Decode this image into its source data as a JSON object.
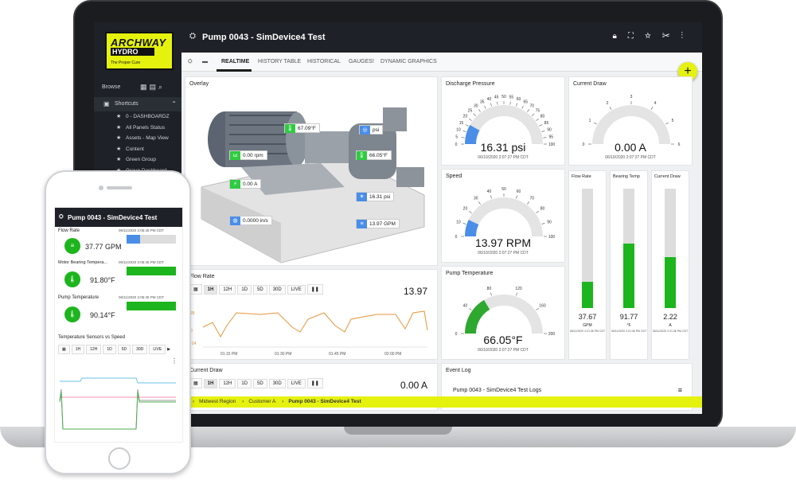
{
  "app": {
    "logo_line1": "ARCHWAY",
    "logo_line2": "HYDRO",
    "logo_tagline": "The Proper Cure",
    "title": "Pump 0043 - SimDevice4 Test",
    "accent": "#e5f20d"
  },
  "sidebar": {
    "browse_label": "Browse",
    "shortcuts_label": "Shortcuts",
    "items": [
      {
        "label": "0 - DASHBOARDZ"
      },
      {
        "label": "All Panels Status"
      },
      {
        "label": "Assets - Map View"
      },
      {
        "label": "Content"
      },
      {
        "label": "Green Group"
      },
      {
        "label": "Group Dashboard"
      }
    ]
  },
  "header": {
    "icons": [
      "lock-icon",
      "fullscreen-icon",
      "star-icon",
      "tools-icon",
      "more-icon"
    ]
  },
  "tabs": [
    {
      "label": "REALTIME"
    },
    {
      "label": "HISTORY TABLE"
    },
    {
      "label": "HISTORICAL"
    },
    {
      "label": "GAUGES!"
    },
    {
      "label": "DYNAMIC GRAPHICS"
    }
  ],
  "overlay": {
    "title": "Overlay",
    "tags": [
      {
        "text": "67.09°F"
      },
      {
        "text": "psi"
      },
      {
        "text": "0.00 rpm"
      },
      {
        "text": "66.05°F"
      },
      {
        "text": "0.00 A"
      },
      {
        "text": "16.31 psi"
      },
      {
        "text": "13.97 GPM"
      },
      {
        "text": "0.0000 in/s"
      }
    ]
  },
  "gauges": {
    "discharge": {
      "title": "Discharge Pressure",
      "value": "16.31 psi",
      "ts": "06/10/2020 2:07:27 PM CDT",
      "level": 0.163,
      "ticks": [
        "0",
        "5",
        "10",
        "15",
        "20",
        "25",
        "30",
        "35",
        "40",
        "45",
        "50",
        "55",
        "60",
        "65",
        "70",
        "75",
        "80",
        "85",
        "90",
        "95",
        "100"
      ]
    },
    "current": {
      "title": "Current Draw",
      "value": "0.00 A",
      "ts": "06/10/2020 2:07:27 PM CDT",
      "level": 0,
      "ticks": [
        "0",
        "1",
        "2",
        "3",
        "4",
        "5",
        "6"
      ]
    },
    "speed": {
      "title": "Speed",
      "value": "13.97 RPM",
      "ts": "06/10/2020 2:07:27 PM CDT",
      "level": 0.14,
      "ticks": [
        "0",
        "10",
        "20",
        "30",
        "40",
        "50",
        "60",
        "70",
        "80",
        "90",
        "100"
      ]
    },
    "temp": {
      "title": "Pump Temperature",
      "value": "66.05°F",
      "ts": "06/10/2020 2:07:27 PM CDT",
      "level": 0.33,
      "ticks": [
        "0",
        "40",
        "80",
        "120",
        "160",
        "200"
      ]
    }
  },
  "flow_chart": {
    "title": "Flow Rate",
    "current": "13.97",
    "ranges": [
      "1H",
      "12H",
      "1D",
      "5D",
      "30D",
      "LIVE"
    ],
    "yticks": [
      "25",
      "0",
      "-14"
    ],
    "xticks": [
      "01:15 PM",
      "01:30 PM",
      "01:45 PM",
      "02:00 PM"
    ]
  },
  "current_chart": {
    "title": "Current Draw",
    "current": "0.00 A",
    "ranges": [
      "1H",
      "12H",
      "1D",
      "5D",
      "30D",
      "LIVE"
    ]
  },
  "vbars": [
    {
      "title": "Flow Rate",
      "value": "37.67",
      "unit": "GPM",
      "ts": "06/11/2020 2:21:36 PM CDT",
      "level": 0.22
    },
    {
      "title": "Bearing Temp",
      "value": "91.77",
      "unit": "°F",
      "ts": "06/11/2020 2:21:36 PM CDT",
      "level": 0.54
    },
    {
      "title": "Current Draw",
      "value": "2.22",
      "unit": "A",
      "ts": "06/11/2020 2:21:36 PM CDT",
      "level": 0.43
    }
  ],
  "event_log": {
    "title": "Event Log",
    "row": "Pump 0043 - SimDevice4 Test Logs"
  },
  "breadcrumb": [
    "Midwest Region",
    "Customer A",
    "Pump 0043 - SimDevice4 Test"
  ],
  "phone": {
    "title": "Pump 0043 - SimDevice4 Test",
    "rows": [
      {
        "label": "Flow Rate",
        "value": "37.77 GPM",
        "ts": "06/11/2020 2:05:45 PM CDT",
        "level": 0.28,
        "color": "#4a8ee8"
      },
      {
        "label": "Motor Bearing Tempera...",
        "value": "91.80°F",
        "ts": "06/11/2020 2:05:45 PM CDT",
        "level": 1.0,
        "color": "#1db51d"
      },
      {
        "label": "Pump Temperature",
        "value": "90.14°F",
        "ts": "06/11/2020 2:05:45 PM CDT",
        "level": 1.0,
        "color": "#1db51d"
      }
    ],
    "chart_title": "Temperature Sensors vs Speed",
    "ranges": [
      "1H",
      "12H",
      "1D",
      "5D",
      "30D",
      "LIVE"
    ]
  }
}
